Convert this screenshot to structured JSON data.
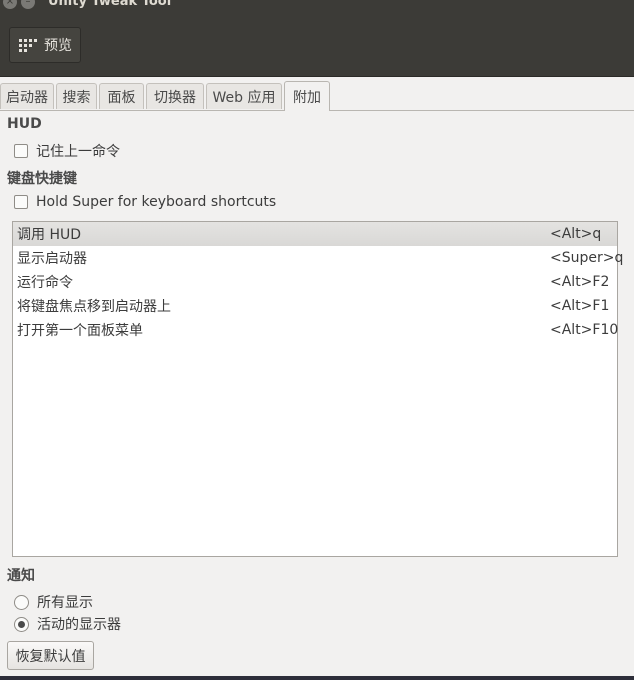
{
  "window": {
    "title": "Unity Tweak Tool"
  },
  "toolbar": {
    "preview_label": "预览"
  },
  "tabs": [
    {
      "label": "启动器"
    },
    {
      "label": "搜索"
    },
    {
      "label": "面板"
    },
    {
      "label": "切换器"
    },
    {
      "label": "Web 应用"
    },
    {
      "label": "附加",
      "active": true
    }
  ],
  "hud": {
    "heading": "HUD",
    "remember_label": "记住上一命令",
    "remember_checked": false
  },
  "shortcuts": {
    "heading": "键盘快捷键",
    "hold_super_label": "Hold Super for keyboard shortcuts",
    "hold_super_checked": false,
    "rows": [
      {
        "name": "调用 HUD",
        "key": "<Alt>q",
        "selected": true
      },
      {
        "name": "显示启动器",
        "key": "<Super>q"
      },
      {
        "name": "运行命令",
        "key": "<Alt>F2"
      },
      {
        "name": "将键盘焦点移到启动器上",
        "key": "<Alt>F1"
      },
      {
        "name": "打开第一个面板菜单",
        "key": "<Alt>F10"
      }
    ]
  },
  "notifications": {
    "heading": "通知",
    "options": [
      {
        "label": "所有显示",
        "checked": false
      },
      {
        "label": "活动的显示器",
        "checked": true
      }
    ]
  },
  "footer": {
    "restore_label": "恢复默认值"
  },
  "colors": {
    "toolbar_bg": "#3c3b37",
    "window_bg": "#f2f1f0"
  }
}
